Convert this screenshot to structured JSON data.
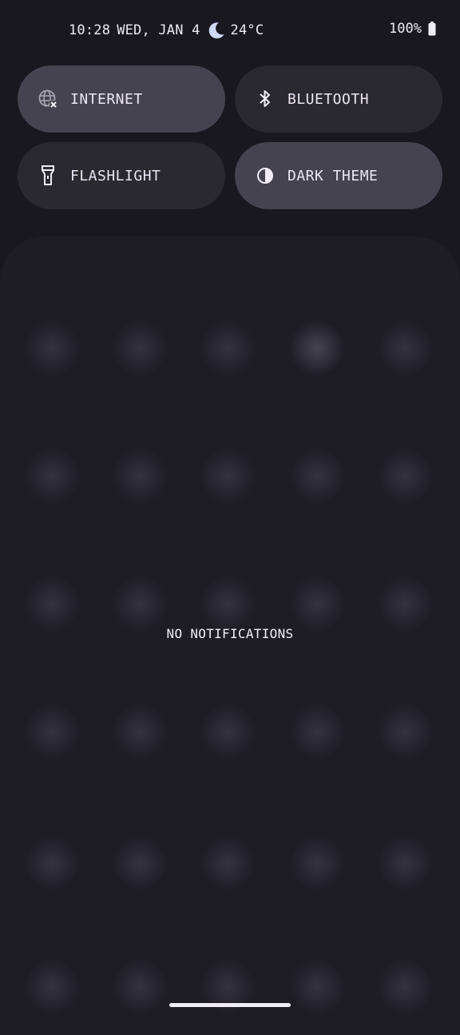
{
  "status_bar": {
    "time": "10:28",
    "date": "WED, JAN 4",
    "weather_icon": "moon-icon",
    "temperature": "24°C",
    "battery_percent": "100%",
    "battery_icon": "battery-full-icon"
  },
  "quick_settings": {
    "tiles": [
      {
        "label": "INTERNET",
        "icon": "globe-off-icon",
        "active": true
      },
      {
        "label": "BLUETOOTH",
        "icon": "bluetooth-icon",
        "active": false
      },
      {
        "label": "FLASHLIGHT",
        "icon": "flashlight-icon",
        "active": false
      },
      {
        "label": "DARK THEME",
        "icon": "contrast-icon",
        "active": true
      }
    ]
  },
  "notifications": {
    "empty_message": "NO NOTIFICATIONS"
  },
  "colors": {
    "background": "#191820",
    "tile_active": "#45434f",
    "tile_inactive": "#2a2930",
    "panel": "#1e1d26",
    "text": "#eae6f3"
  }
}
